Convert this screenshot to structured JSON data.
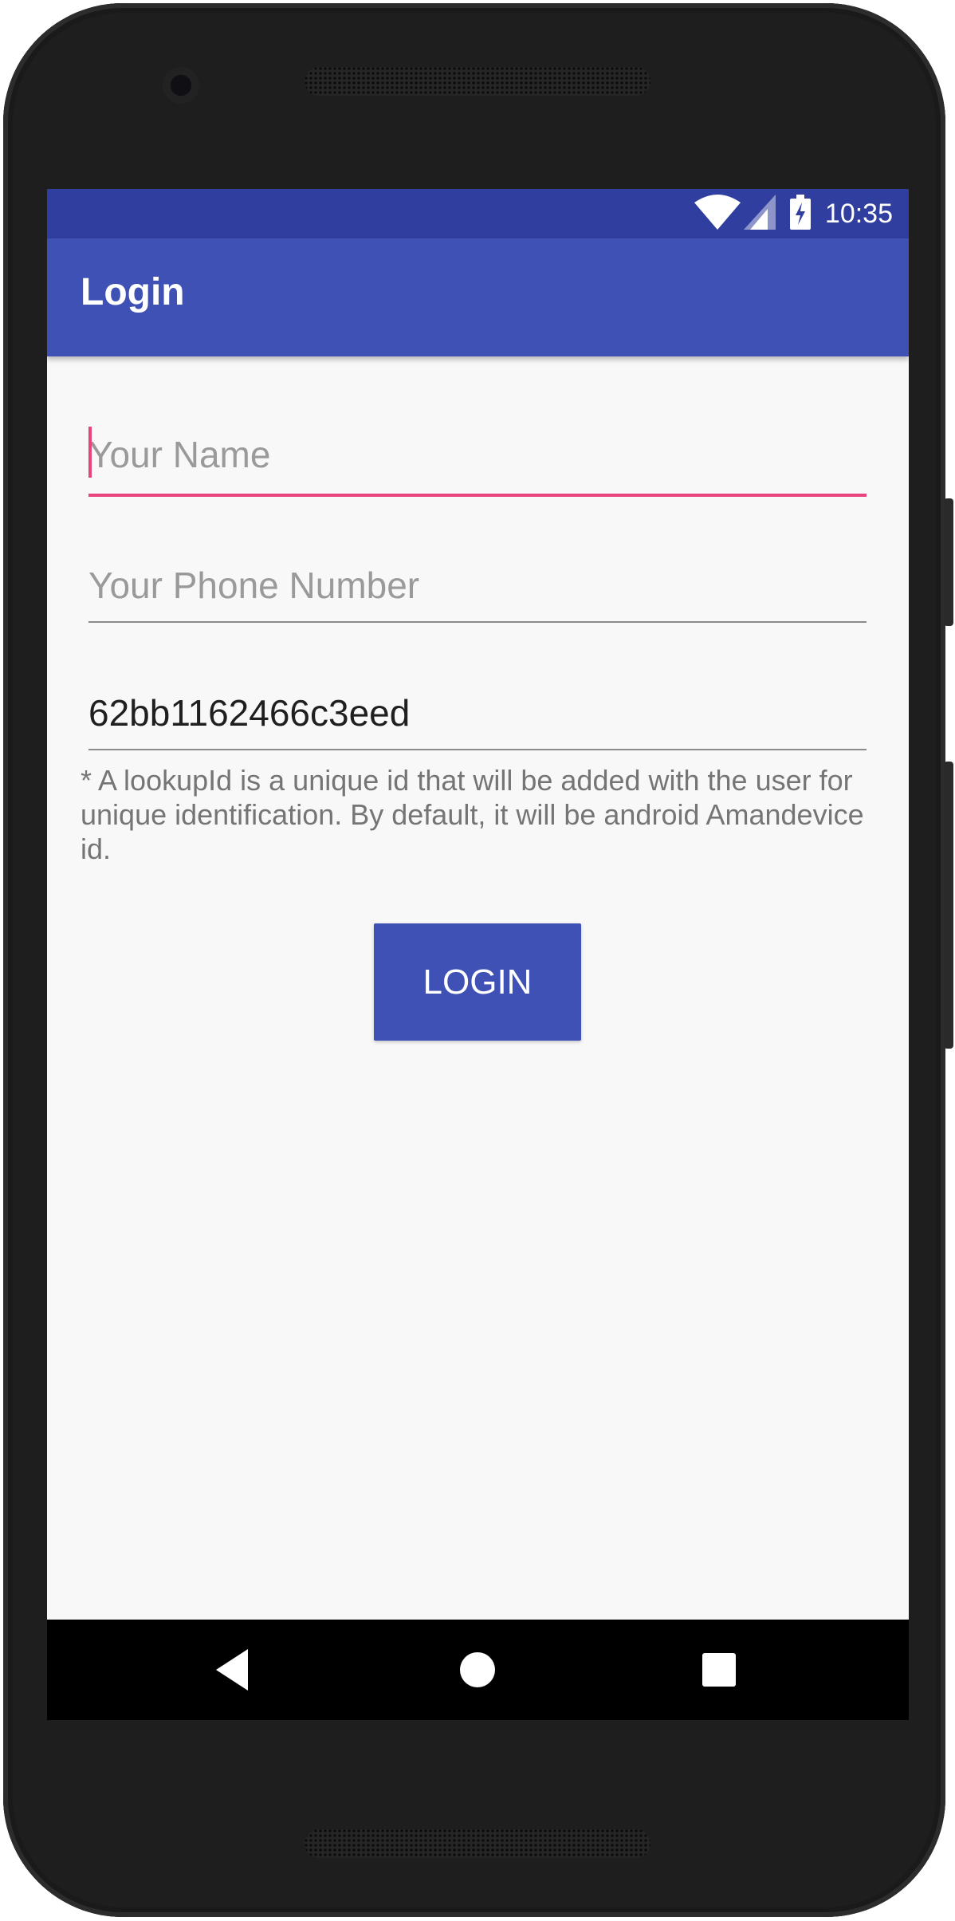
{
  "status_bar": {
    "time": "10:35",
    "wifi_icon": "wifi-icon",
    "signal_icon": "cell-signal-icon",
    "battery_icon": "battery-charging-icon"
  },
  "app_bar": {
    "title": "Login"
  },
  "form": {
    "name": {
      "value": "",
      "placeholder": "Your Name"
    },
    "phone": {
      "value": "",
      "placeholder": "Your Phone Number"
    },
    "lookup_id": {
      "value": "62bb1162466c3eed",
      "placeholder": ""
    },
    "hint": "* A lookupId is a unique id that will be added with the user for unique identification. By default, it will be android Amandevice id.",
    "login_label": "LOGIN"
  },
  "nav": {
    "back_icon": "back-icon",
    "home_icon": "home-icon",
    "recents_icon": "recents-icon"
  },
  "colors": {
    "primary": "#3f51b5",
    "primary_dark": "#303f9f",
    "accent": "#e8437d",
    "background": "#f8f8f8"
  }
}
